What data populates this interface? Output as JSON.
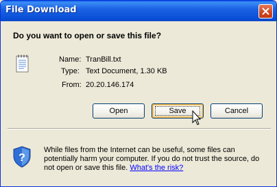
{
  "window": {
    "title": "File Download"
  },
  "dialog": {
    "question": "Do you want to open or save this file?",
    "fields": [
      {
        "label": "Name:",
        "value": "TranBill.txt"
      },
      {
        "label": "Type:",
        "value": "Text Document, 1.30 KB"
      },
      {
        "label": "From:",
        "value": "20.20.146.174"
      }
    ],
    "buttons": {
      "open": "Open",
      "save": "Save",
      "cancel": "Cancel"
    },
    "warning": {
      "text": "While files from the Internet can be useful, some files can potentially harm your computer. If you do not trust the source, do not open or save this file.",
      "link": "What's the risk?"
    }
  },
  "icons": {
    "file": "text-document-icon",
    "shield": "security-shield-icon",
    "close": "close-icon"
  },
  "colors": {
    "titlebar": "#0a58e0",
    "close": "#d0451e",
    "link": "#0000ff"
  }
}
